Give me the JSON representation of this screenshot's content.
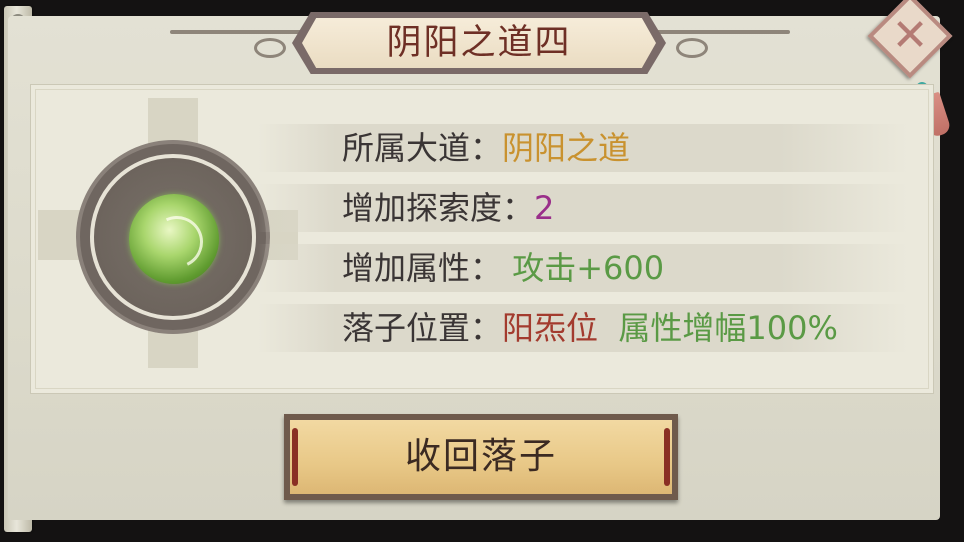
{
  "dialog": {
    "title": "阴阳之道四"
  },
  "info": {
    "rows": [
      {
        "label": "所属大道：",
        "value": "阴阳之道",
        "value_color": "#c9922f"
      },
      {
        "label": "增加探索度：",
        "value": "2",
        "value_color": "#9a2f8a"
      },
      {
        "label": "增加属性：",
        "value": "攻击+600",
        "value_color": "#5a9a45"
      },
      {
        "label": "落子位置：",
        "value": "阳炁位",
        "value_color": "#a33b2e",
        "extra": "属性增幅100%",
        "extra_color": "#5a9a45"
      }
    ]
  },
  "actions": {
    "withdraw_label": "收回落子"
  },
  "icons": {
    "close": "close-icon",
    "orb": "green-orb-icon",
    "tassel": "tassel-icon"
  }
}
